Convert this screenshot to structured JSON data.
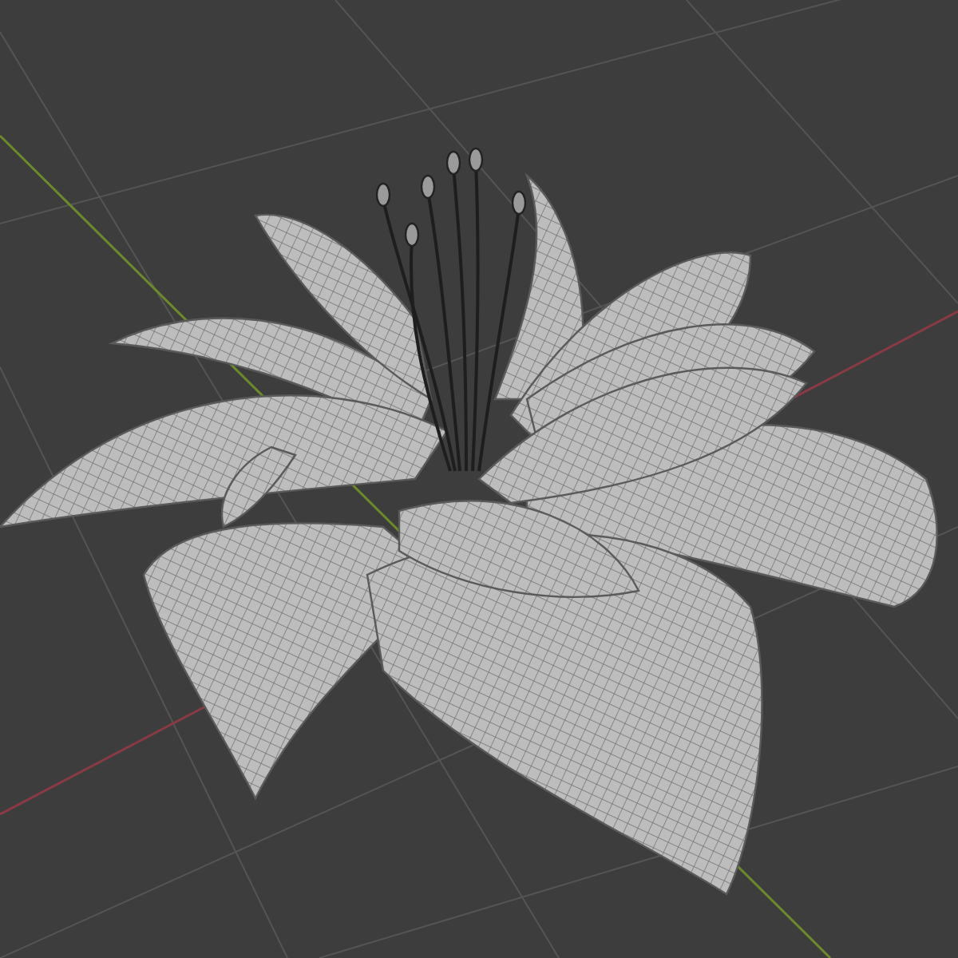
{
  "viewport": {
    "grid_floor": true,
    "x_axis": true,
    "y_axis": true
  }
}
